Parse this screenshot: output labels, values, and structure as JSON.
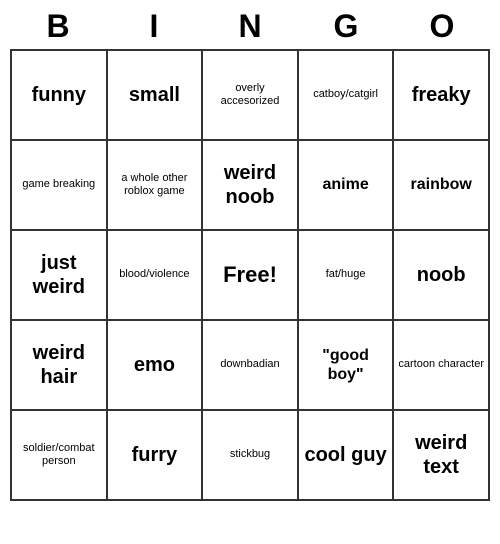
{
  "header": {
    "letters": [
      "B",
      "I",
      "N",
      "G",
      "O"
    ]
  },
  "grid": [
    [
      {
        "text": "funny",
        "size": "large"
      },
      {
        "text": "small",
        "size": "large"
      },
      {
        "text": "overly accesorized",
        "size": "small"
      },
      {
        "text": "catboy/catgirl",
        "size": "small"
      },
      {
        "text": "freaky",
        "size": "large"
      }
    ],
    [
      {
        "text": "game breaking",
        "size": "small"
      },
      {
        "text": "a whole other roblox game",
        "size": "small"
      },
      {
        "text": "weird noob",
        "size": "large"
      },
      {
        "text": "anime",
        "size": "medium"
      },
      {
        "text": "rainbow",
        "size": "medium"
      }
    ],
    [
      {
        "text": "just weird",
        "size": "large"
      },
      {
        "text": "blood/violence",
        "size": "small"
      },
      {
        "text": "Free!",
        "size": "free"
      },
      {
        "text": "fat/huge",
        "size": "small"
      },
      {
        "text": "noob",
        "size": "large"
      }
    ],
    [
      {
        "text": "weird hair",
        "size": "large"
      },
      {
        "text": "emo",
        "size": "large"
      },
      {
        "text": "downbadian",
        "size": "small"
      },
      {
        "text": "\"good boy\"",
        "size": "medium"
      },
      {
        "text": "cartoon character",
        "size": "small"
      }
    ],
    [
      {
        "text": "soldier/combat person",
        "size": "small"
      },
      {
        "text": "furry",
        "size": "large"
      },
      {
        "text": "stickbug",
        "size": "small"
      },
      {
        "text": "cool guy",
        "size": "large"
      },
      {
        "text": "weird text",
        "size": "large"
      }
    ]
  ]
}
